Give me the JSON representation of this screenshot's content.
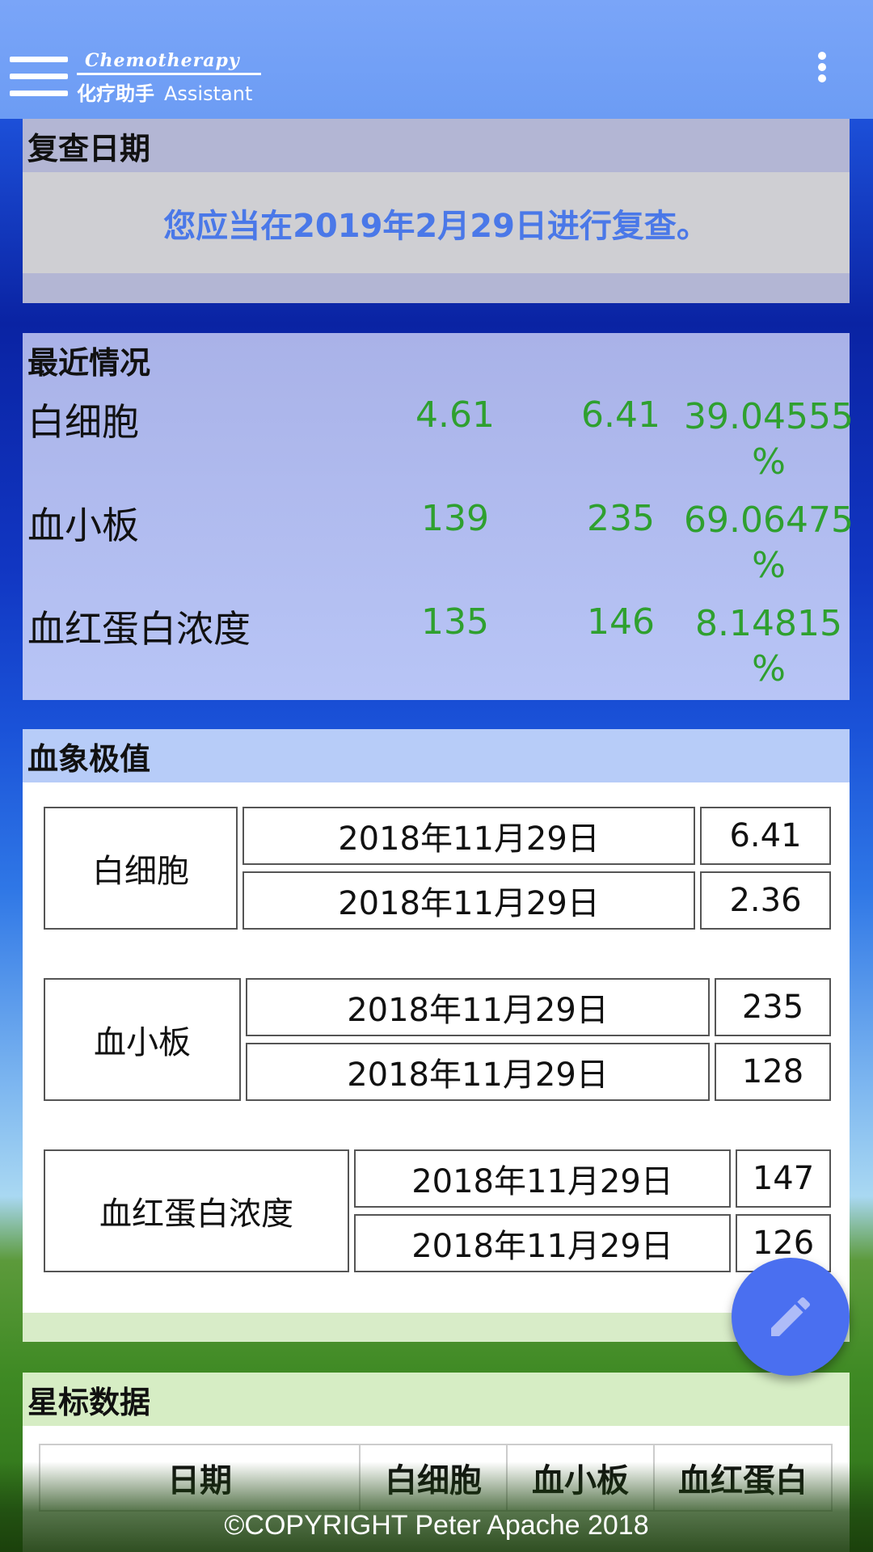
{
  "appbar": {
    "logo_top": "Chemotherapy",
    "logo_cn": "化疗助手",
    "logo_en": "Assistant",
    "menu_icon": "menu-icon",
    "more_icon": "more-vert-icon"
  },
  "recheck": {
    "title": "复查日期",
    "message": "您应当在2019年2月29日进行复查。"
  },
  "recent": {
    "title": "最近情况",
    "rows": [
      {
        "name": "白细胞",
        "v1": "4.61",
        "v2": "6.41",
        "pct": "39.04555",
        "unit": "%"
      },
      {
        "name": "血小板",
        "v1": "139",
        "v2": "235",
        "pct": "69.06475",
        "unit": "%"
      },
      {
        "name": "血红蛋白浓度",
        "v1": "135",
        "v2": "146",
        "pct": "8.14815",
        "unit": "%"
      }
    ]
  },
  "extreme": {
    "title": "血象极值",
    "groups": [
      {
        "name": "白细胞",
        "max_date": "2018年11月29日",
        "max_value": "6.41",
        "min_date": "2018年11月29日",
        "min_value": "2.36"
      },
      {
        "name": "血小板",
        "max_date": "2018年11月29日",
        "max_value": "235",
        "min_date": "2018年11月29日",
        "min_value": "128"
      },
      {
        "name": "血红蛋白浓度",
        "max_date": "2018年11月29日",
        "max_value": "147",
        "min_date": "2018年11月29日",
        "min_value": "126"
      }
    ]
  },
  "star": {
    "title": "星标数据",
    "headers": [
      "日期",
      "白细胞",
      "血小板",
      "血红蛋白"
    ]
  },
  "footer": {
    "copyright": "©COPYRIGHT Peter Apache 2018"
  },
  "fab": {
    "icon": "edit-pencil-icon"
  },
  "colors": {
    "appbar": "#6c9cf4",
    "accent_text": "#4a78e8",
    "value_green": "#2fa02f",
    "fab": "#4a6ff0"
  }
}
